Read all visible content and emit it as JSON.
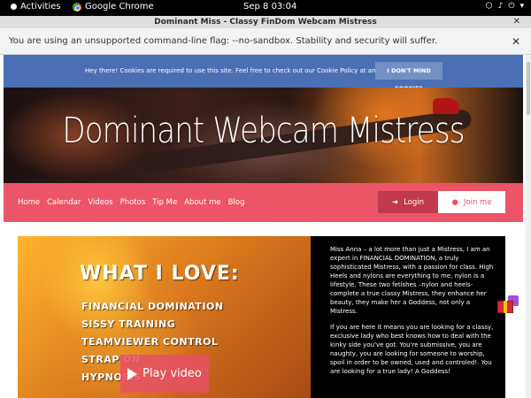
{
  "system_bar": {
    "activities": "Activities",
    "app_name": "Google Chrome",
    "clock": "Sep 8  03:04"
  },
  "window": {
    "title": "Dominant Miss - Classy FinDom Webcam Mistress"
  },
  "infobar": {
    "message": "You are using an unsupported command-line flag: --no-sandbox. Stability and security will suffer."
  },
  "cookie_banner": {
    "message": "Hey there! Cookies are required to use this site. Feel free to check out our Cookie Policy at any time.",
    "button": "I DON'T MIND COOKIES"
  },
  "hero": {
    "title": "Dominant Webcam Mistress"
  },
  "nav": {
    "links": [
      "Home",
      "Calendar",
      "Videos",
      "Photos",
      "Tip Me",
      "About me",
      "Blog"
    ],
    "login": "Login",
    "join": "Join me"
  },
  "video": {
    "heading": "WHAT I LOVE:",
    "list": [
      "FINANCIAL DOMINATION",
      "SISSY TRAINING",
      "TEAMVIEWER CONTROL",
      "STRAP ON",
      "HYPNOSIS"
    ],
    "play_label": "Play video"
  },
  "bio": {
    "paragraph1": "Miss Anna – a lot more than just a Mistress, I am an expert in FINANCIAL DOMINATION, a truly sophisticated Mistress, with a passion for class. High Heels and nylons are everything to me, nylon is a lifestyle. These two fetishes –nylon and heels- complete a true classy Mistress, they enhance her beauty, they make her a Goddess, not only a Mistress.",
    "paragraph2": "If you are here it means you are looking for a classy, exclusive lady who best knows how to deal with the kinky side you've got. You're submissive, you are naughty, you are looking for someone to worship, spoil in order to be owned, used and controled!. You are looking for a true lady! A Goddess!"
  },
  "colors": {
    "nav": "#ec5468",
    "cookie": "#4b6fb5",
    "bio_bg": "#000000"
  }
}
